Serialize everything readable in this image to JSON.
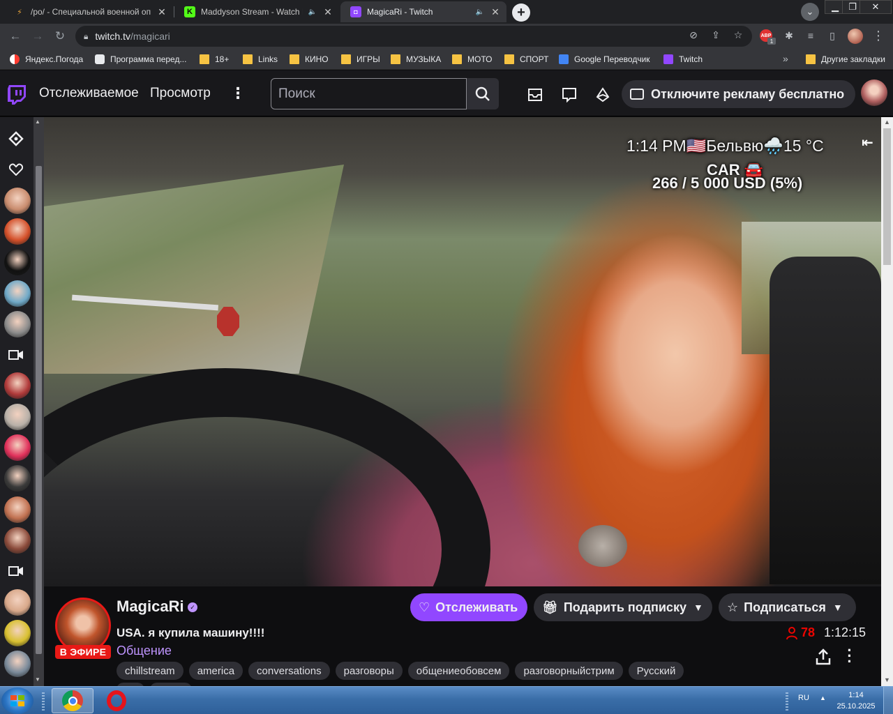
{
  "browser": {
    "tabs": [
      {
        "title": "/po/ - Специальной военной оп",
        "icon": "lightning-icon",
        "active": false
      },
      {
        "title": "Maddyson Stream - Watch Li",
        "icon": "kick-icon",
        "active": false,
        "audio": true
      },
      {
        "title": "MagicaRi - Twitch",
        "icon": "twitch-icon",
        "active": true,
        "audio": true
      }
    ],
    "url_domain": "twitch.tv",
    "url_path": "/magicari",
    "extension_badge": "1",
    "bookmarks": [
      {
        "label": "Яндекс.Погода",
        "icon": "yandex-weather-icon"
      },
      {
        "label": "Программа перед...",
        "icon": "tv-program-icon"
      },
      {
        "label": "18+",
        "icon": "folder-icon"
      },
      {
        "label": "Links",
        "icon": "folder-icon"
      },
      {
        "label": "КИНО",
        "icon": "folder-icon"
      },
      {
        "label": "ИГРЫ",
        "icon": "folder-icon"
      },
      {
        "label": "МУЗЫКА",
        "icon": "folder-icon"
      },
      {
        "label": "МОТО",
        "icon": "folder-icon"
      },
      {
        "label": "СПОРТ",
        "icon": "folder-icon"
      },
      {
        "label": "Google Переводчик",
        "icon": "google-translate-icon"
      },
      {
        "label": "Twitch",
        "icon": "twitch-icon"
      }
    ],
    "bookmarks_overflow": "»",
    "other_bookmarks": "Другие закладки"
  },
  "twitch": {
    "nav": {
      "following": "Отслеживаемое",
      "browse": "Просмотр",
      "search_placeholder": "Поиск",
      "ad_free": "Отключите рекламу бесплатно"
    },
    "sidebar": [
      {
        "type": "glyph",
        "icon": "recommended-icon"
      },
      {
        "type": "glyph",
        "icon": "heart-icon"
      },
      {
        "type": "avatar",
        "color": "#c98c6e"
      },
      {
        "type": "avatar",
        "color": "#d4502a"
      },
      {
        "type": "avatar",
        "color": "#111111"
      },
      {
        "type": "avatar",
        "color": "#6fa9c8"
      },
      {
        "type": "avatar",
        "color": "#8c8c8c"
      },
      {
        "type": "glyph",
        "icon": "video-camera-icon"
      },
      {
        "type": "avatar",
        "color": "#b03a3a"
      },
      {
        "type": "avatar",
        "color": "#b8b0a8"
      },
      {
        "type": "avatar",
        "color": "#e0305a"
      },
      {
        "type": "avatar",
        "color": "#3a3a3a"
      },
      {
        "type": "avatar",
        "color": "#c07050"
      },
      {
        "type": "avatar",
        "color": "#8a4a3a"
      },
      {
        "type": "glyph",
        "icon": "video-camera-icon"
      },
      {
        "type": "avatar",
        "color": "#d8a88a"
      },
      {
        "type": "avatar",
        "color": "#d8c030"
      },
      {
        "type": "avatar",
        "color": "#7a8a9a"
      }
    ],
    "video_overlay": {
      "time_location": "1:14 PM🇺🇸Бельвю🌧️15 °C",
      "goal_label": "CAR 🚘",
      "goal_progress": "266 / 5 000 USD (5%)"
    },
    "channel": {
      "name": "MagicaRi",
      "live_badge": "В ЭФИРЕ",
      "title": "USA. я купила машину!!!!",
      "category": "Общение",
      "tags": [
        "chillstream",
        "america",
        "conversations",
        "разговоры",
        "общениеобовсем",
        "разговорныйстрим",
        "Русский"
      ],
      "follow_label": "Отслеживать",
      "gift_label": "Подарить подписку",
      "subscribe_label": "Подписаться",
      "viewers": "78",
      "uptime": "1:12:15"
    }
  },
  "taskbar": {
    "language": "RU",
    "time": "1:14",
    "date": "25.10.2025"
  },
  "colors": {
    "twitch_purple": "#9147ff",
    "live_red": "#e91916",
    "category_purple": "#bf94ff"
  }
}
